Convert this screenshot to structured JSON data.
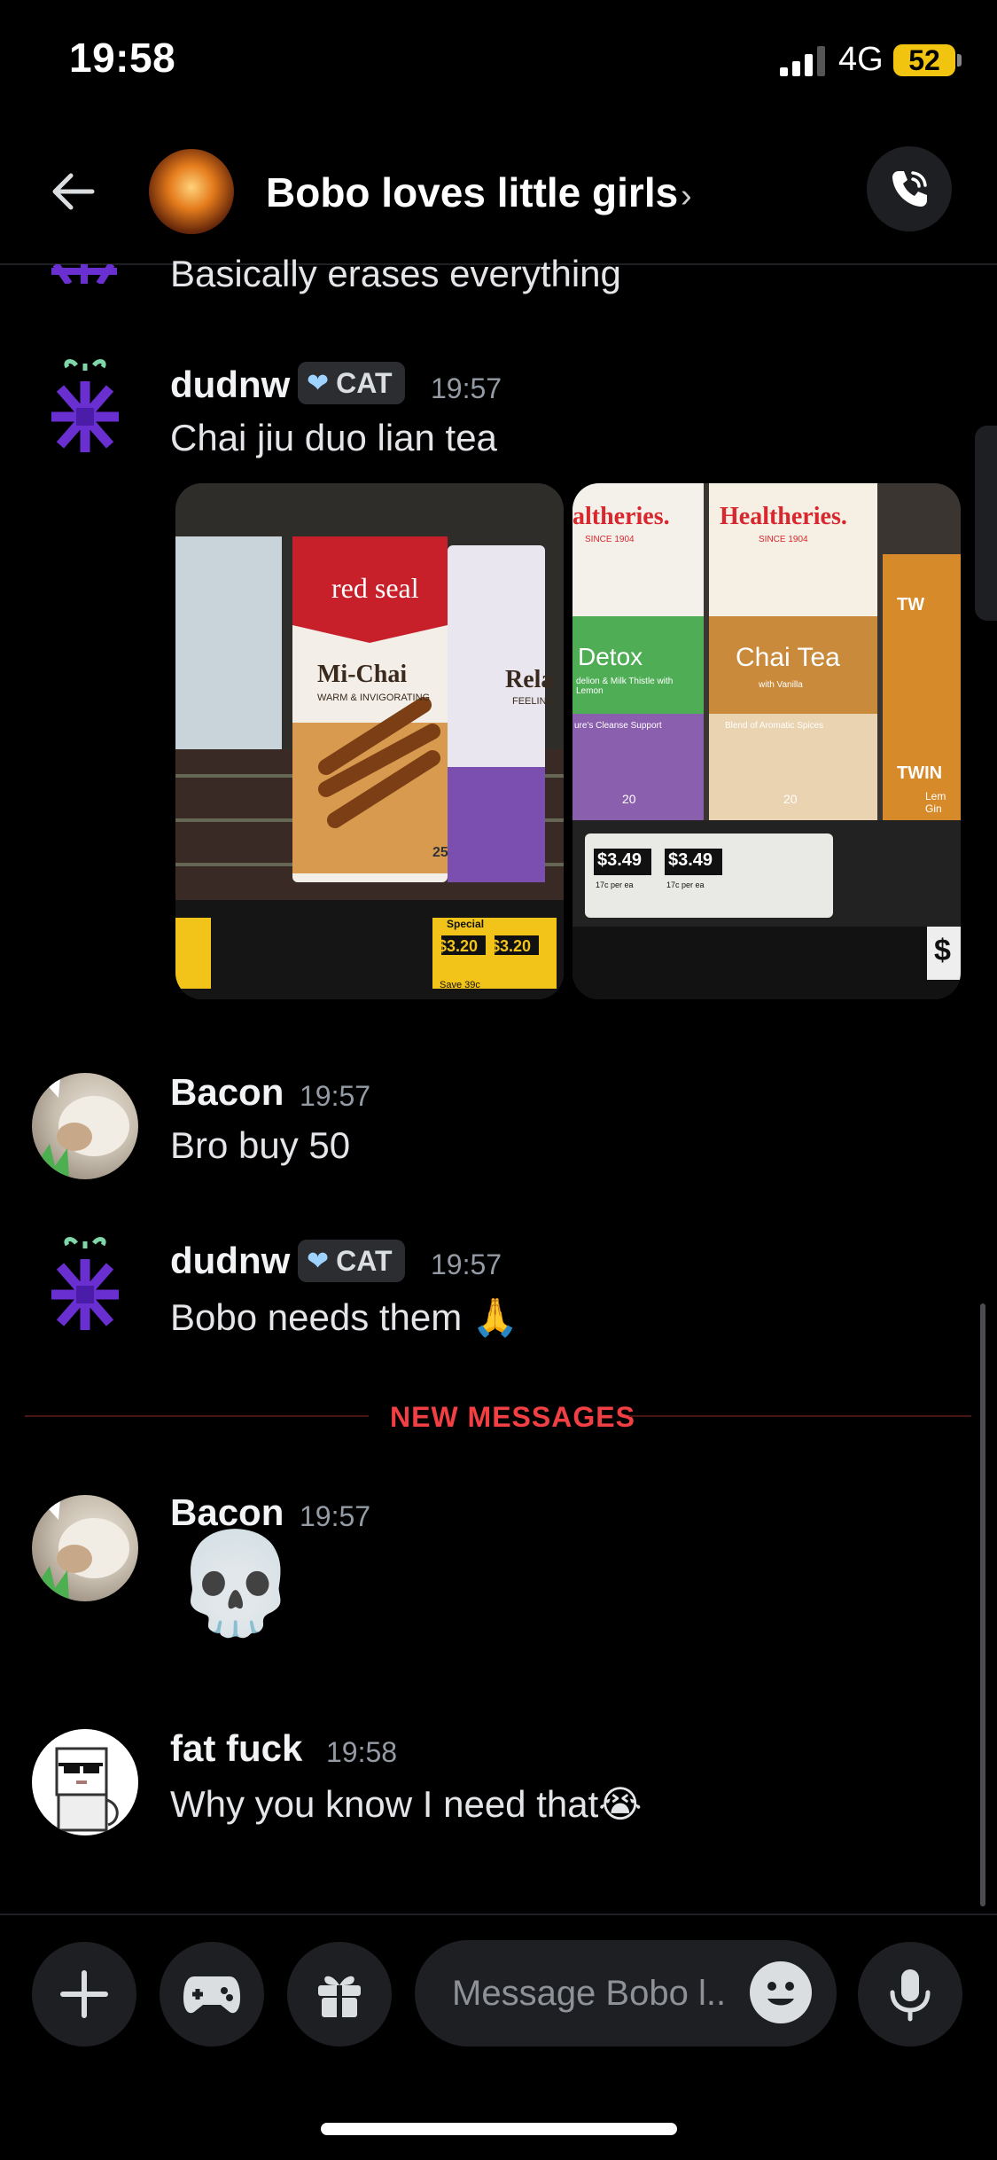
{
  "status_bar": {
    "time": "19:58",
    "network": "4G",
    "battery": "52"
  },
  "header": {
    "channel_title": "Bobo loves little girls",
    "chevron": "›"
  },
  "messages": [
    {
      "id": "partial",
      "text": "Basically erases everything"
    },
    {
      "id": "m1",
      "username": "dudnw",
      "tag": "CAT",
      "time": "19:57",
      "text": "Chai jiu duo lian tea",
      "images": [
        {
          "label": "red seal Mi-Chai tea box",
          "brand": "red seal",
          "name": "Mi-Chai",
          "sub": "WARM & INVIGORATING",
          "second_box": "Rela",
          "second_sub": "FEELING",
          "price1": "$3.20",
          "price2": "$3.20",
          "special": "Special",
          "save": "Save 39c",
          "count": "25"
        },
        {
          "label": "Healtheries Detox and Chai Tea boxes",
          "brand1": "altheries.",
          "brand2": "Healtheries.",
          "since": "SINCE 1904",
          "detox": "Detox",
          "detox_sub": "delion & Milk Thistle with Lemon",
          "detox_band": "ure's Cleanse Support",
          "chai": "Chai Tea",
          "chai_sub": "with Vanilla",
          "chai_band": "Blend of Aromatic Spices",
          "price1": "$3.49",
          "price2": "$3.49",
          "per": "17c per ea",
          "count": "20",
          "twin": "TW",
          "twin2": "TWIN",
          "lem": "Lem Gin",
          "edge_price": "$"
        }
      ]
    },
    {
      "id": "m2",
      "username": "Bacon",
      "time": "19:57",
      "text": "Bro buy 50"
    },
    {
      "id": "m3",
      "username": "dudnw",
      "tag": "CAT",
      "time": "19:57",
      "text": "Bobo needs them",
      "emoji": "🙏"
    },
    {
      "id": "m4",
      "username": "Bacon",
      "time": "19:57",
      "emoji": "💀"
    },
    {
      "id": "m5",
      "username": "fat fuck",
      "time": "19:58",
      "text": "Why you know I need that",
      "emoji": "😭"
    }
  ],
  "divider": {
    "label": "NEW MESSAGES"
  },
  "composer": {
    "placeholder": "Message Bobo l.."
  },
  "icons": [
    "back-arrow-icon",
    "phone-call-icon",
    "plus-icon",
    "gamepad-icon",
    "gift-icon",
    "emoji-icon",
    "microphone-icon"
  ],
  "colors": {
    "accent_red": "#f23f43",
    "bg": "#000000",
    "surface": "#1e1f22",
    "badge_heart": "#9fd3ff"
  }
}
